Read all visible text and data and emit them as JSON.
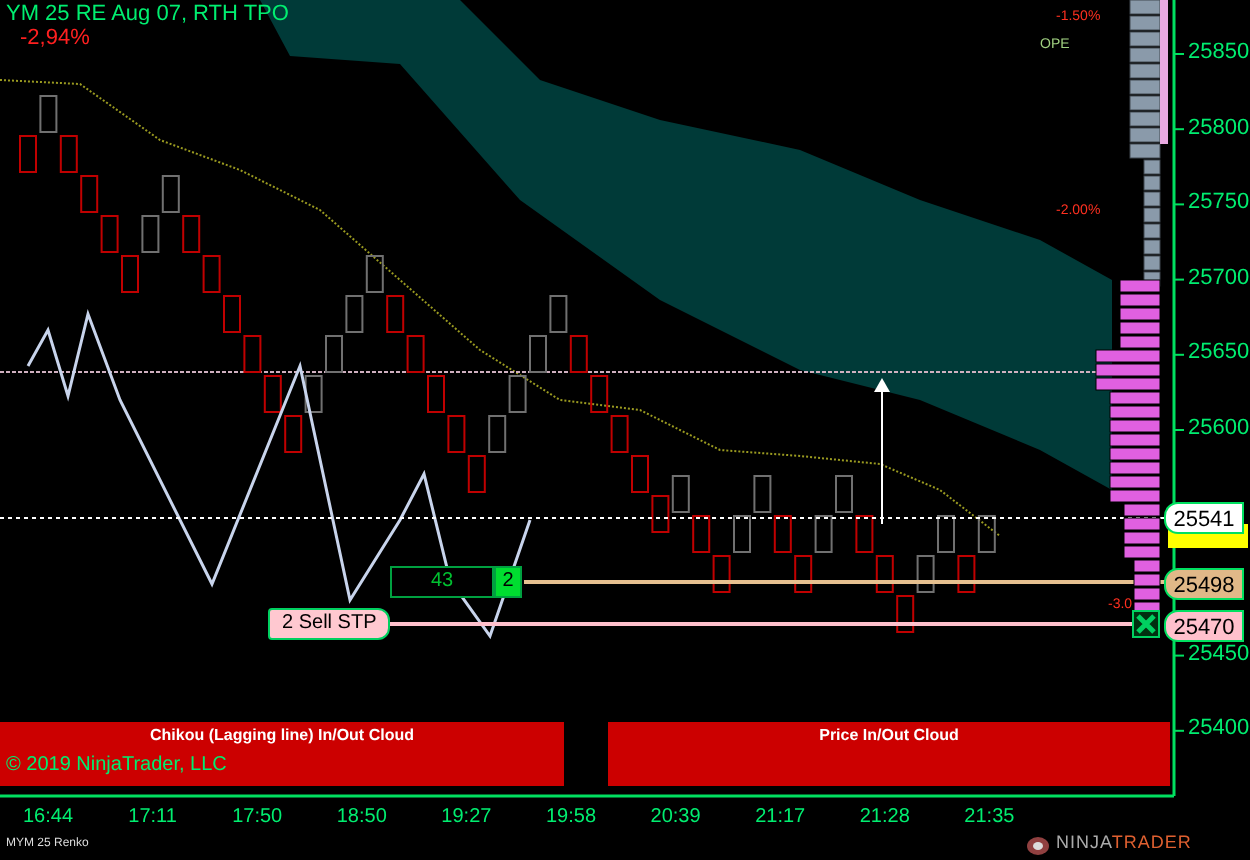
{
  "header": {
    "title": "YM 25 RE Aug 07, RTH TPO",
    "change": "-2,94%"
  },
  "profile_labels": [
    {
      "text": "-1.50%",
      "kind": "percent"
    },
    {
      "text": "OPE",
      "kind": "open"
    },
    {
      "text": "-2.00%",
      "kind": "percent"
    },
    {
      "text": "-3.0",
      "kind": "percent"
    }
  ],
  "order": {
    "quantity": "43",
    "count": "2",
    "tag": "2  Sell STP"
  },
  "price_ticks": [
    "25850",
    "25800",
    "25750",
    "25700",
    "25650",
    "25600",
    "25450",
    "25400"
  ],
  "price_markers": [
    {
      "text": "25541",
      "kind": "last"
    },
    {
      "text": "25498",
      "kind": "position"
    },
    {
      "text": "25470",
      "kind": "stop"
    }
  ],
  "banners": [
    "Chikou (Lagging line) In/Out Cloud",
    "Price In/Out Cloud"
  ],
  "copyright": "© 2019 NinjaTrader, LLC",
  "time_ticks": [
    "16:44",
    "17:11",
    "17:50",
    "18:50",
    "19:27",
    "19:58",
    "20:39",
    "21:17",
    "21:28",
    "21:35"
  ],
  "footer": {
    "instrument": "MYM 25 Renko",
    "logo": [
      "NINJA",
      "TRADER"
    ]
  }
}
